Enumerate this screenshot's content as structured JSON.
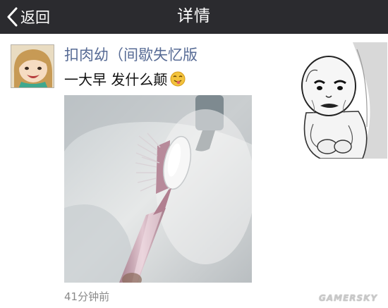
{
  "header": {
    "back_label": "返回",
    "title": "详情"
  },
  "post": {
    "username": "扣肉幼（间歇失忆版",
    "text": "一大早 发什么颠",
    "emoji": "tongue-out-drunk-emoji-icon",
    "timestamp": "41分钟前"
  },
  "watermark": "GAMERSKY",
  "colors": {
    "topbar": "#2b2b2f",
    "username": "#576b95",
    "timestamp": "#8a8a8a"
  }
}
